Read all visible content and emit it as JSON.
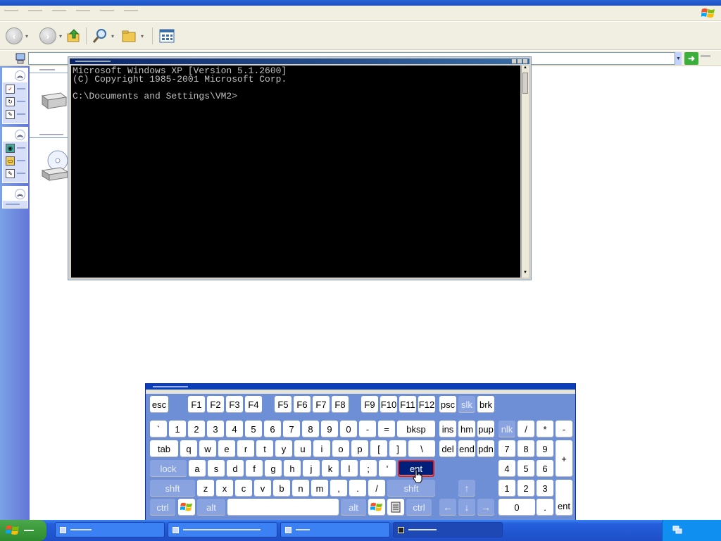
{
  "cmd": {
    "lines": [
      "Microsoft Windows XP [Version 5.1.2600]",
      "(C) Copyright 1985-2001 Microsoft Corp.",
      "",
      "C:\\Documents and Settings\\VM2>"
    ]
  },
  "keyboard": {
    "rows": [
      [
        {
          "label": "esc",
          "name": "key-esc"
        },
        {
          "label": "F1",
          "name": "key-f1"
        },
        {
          "label": "F2",
          "name": "key-f2"
        },
        {
          "label": "F3",
          "name": "key-f3"
        },
        {
          "label": "F4",
          "name": "key-f4"
        },
        {
          "label": "F5",
          "name": "key-f5"
        },
        {
          "label": "F6",
          "name": "key-f6"
        },
        {
          "label": "F7",
          "name": "key-f7"
        },
        {
          "label": "F8",
          "name": "key-f8"
        },
        {
          "label": "F9",
          "name": "key-f9"
        },
        {
          "label": "F10",
          "name": "key-f10"
        },
        {
          "label": "F11",
          "name": "key-f11"
        },
        {
          "label": "F12",
          "name": "key-f12"
        },
        {
          "label": "psc",
          "name": "key-psc"
        },
        {
          "label": "slk",
          "name": "key-slk",
          "style": "mod"
        },
        {
          "label": "brk",
          "name": "key-brk"
        }
      ],
      [
        {
          "label": "`",
          "name": "key-backtick"
        },
        {
          "label": "1",
          "name": "key-1"
        },
        {
          "label": "2",
          "name": "key-2"
        },
        {
          "label": "3",
          "name": "key-3"
        },
        {
          "label": "4",
          "name": "key-4"
        },
        {
          "label": "5",
          "name": "key-5"
        },
        {
          "label": "6",
          "name": "key-6"
        },
        {
          "label": "7",
          "name": "key-7"
        },
        {
          "label": "8",
          "name": "key-8"
        },
        {
          "label": "9",
          "name": "key-9"
        },
        {
          "label": "0",
          "name": "key-0"
        },
        {
          "label": "-",
          "name": "key-minus"
        },
        {
          "label": "=",
          "name": "key-equals"
        },
        {
          "label": "bksp",
          "name": "key-bksp"
        },
        {
          "label": "ins",
          "name": "key-ins"
        },
        {
          "label": "hm",
          "name": "key-hm"
        },
        {
          "label": "pup",
          "name": "key-pup"
        },
        {
          "label": "nlk",
          "name": "key-nlk",
          "style": "nlk"
        },
        {
          "label": "/",
          "name": "key-num-slash"
        },
        {
          "label": "*",
          "name": "key-num-star"
        },
        {
          "label": "-",
          "name": "key-num-minus"
        }
      ],
      [
        {
          "label": "tab",
          "name": "key-tab"
        },
        {
          "label": "q",
          "name": "key-q"
        },
        {
          "label": "w",
          "name": "key-w"
        },
        {
          "label": "e",
          "name": "key-e"
        },
        {
          "label": "r",
          "name": "key-r"
        },
        {
          "label": "t",
          "name": "key-t"
        },
        {
          "label": "y",
          "name": "key-y"
        },
        {
          "label": "u",
          "name": "key-u"
        },
        {
          "label": "i",
          "name": "key-i"
        },
        {
          "label": "o",
          "name": "key-o"
        },
        {
          "label": "p",
          "name": "key-p"
        },
        {
          "label": "[",
          "name": "key-lbracket"
        },
        {
          "label": "]",
          "name": "key-rbracket"
        },
        {
          "label": "\\",
          "name": "key-backslash"
        },
        {
          "label": "del",
          "name": "key-del"
        },
        {
          "label": "end",
          "name": "key-end"
        },
        {
          "label": "pdn",
          "name": "key-pdn"
        },
        {
          "label": "7",
          "name": "key-num-7"
        },
        {
          "label": "8",
          "name": "key-num-8"
        },
        {
          "label": "9",
          "name": "key-num-9"
        },
        {
          "label": "+",
          "name": "key-num-plus"
        }
      ],
      [
        {
          "label": "lock",
          "name": "key-caps-lock",
          "style": "mod"
        },
        {
          "label": "a",
          "name": "key-a"
        },
        {
          "label": "s",
          "name": "key-s"
        },
        {
          "label": "d",
          "name": "key-d"
        },
        {
          "label": "f",
          "name": "key-f"
        },
        {
          "label": "g",
          "name": "key-g"
        },
        {
          "label": "h",
          "name": "key-h"
        },
        {
          "label": "j",
          "name": "key-j"
        },
        {
          "label": "k",
          "name": "key-k"
        },
        {
          "label": "l",
          "name": "key-l"
        },
        {
          "label": ";",
          "name": "key-semicolon"
        },
        {
          "label": "'",
          "name": "key-quote"
        },
        {
          "label": "ent",
          "name": "key-enter",
          "style": "active"
        },
        {
          "label": "4",
          "name": "key-num-4"
        },
        {
          "label": "5",
          "name": "key-num-5"
        },
        {
          "label": "6",
          "name": "key-num-6"
        }
      ],
      [
        {
          "label": "shft",
          "name": "key-left-shift",
          "style": "mod"
        },
        {
          "label": "z",
          "name": "key-z"
        },
        {
          "label": "x",
          "name": "key-x"
        },
        {
          "label": "c",
          "name": "key-c"
        },
        {
          "label": "v",
          "name": "key-v"
        },
        {
          "label": "b",
          "name": "key-b"
        },
        {
          "label": "n",
          "name": "key-n"
        },
        {
          "label": "m",
          "name": "key-m"
        },
        {
          "label": ",",
          "name": "key-comma"
        },
        {
          "label": ".",
          "name": "key-period"
        },
        {
          "label": "/",
          "name": "key-slash"
        },
        {
          "label": "shft",
          "name": "key-right-shift",
          "style": "mod"
        },
        {
          "label": "↑",
          "name": "key-arrow-up",
          "style": "arrow"
        },
        {
          "label": "1",
          "name": "key-num-1"
        },
        {
          "label": "2",
          "name": "key-num-2"
        },
        {
          "label": "3",
          "name": "key-num-3"
        },
        {
          "label": "ent",
          "name": "key-num-enter"
        }
      ],
      [
        {
          "label": "ctrl",
          "name": "key-left-ctrl",
          "style": "mod"
        },
        {
          "label": "",
          "name": "key-left-windows"
        },
        {
          "label": "alt",
          "name": "key-left-alt",
          "style": "mod"
        },
        {
          "label": "",
          "name": "key-space"
        },
        {
          "label": "alt",
          "name": "key-right-alt",
          "style": "mod"
        },
        {
          "label": "",
          "name": "key-right-windows"
        },
        {
          "label": "",
          "name": "key-menu"
        },
        {
          "label": "ctrl",
          "name": "key-right-ctrl",
          "style": "mod"
        },
        {
          "label": "←",
          "name": "key-arrow-left",
          "style": "arrow"
        },
        {
          "label": "↓",
          "name": "key-arrow-down",
          "style": "arrow"
        },
        {
          "label": "→",
          "name": "key-arrow-right",
          "style": "arrow"
        },
        {
          "label": "0",
          "name": "key-num-0"
        },
        {
          "label": ".",
          "name": "key-num-period"
        }
      ]
    ]
  },
  "icons": {
    "back": "back-arrow-icon",
    "forward": "forward-arrow-icon",
    "up": "folder-up-icon",
    "search": "search-icon",
    "folders": "folders-icon",
    "views": "views-icon",
    "go": "go-arrow-icon"
  },
  "colors": {
    "taskbar": "#245edb",
    "start": "#2e8b2e",
    "osk_bg": "#6e8fd5",
    "active_key": "#001f7a"
  }
}
